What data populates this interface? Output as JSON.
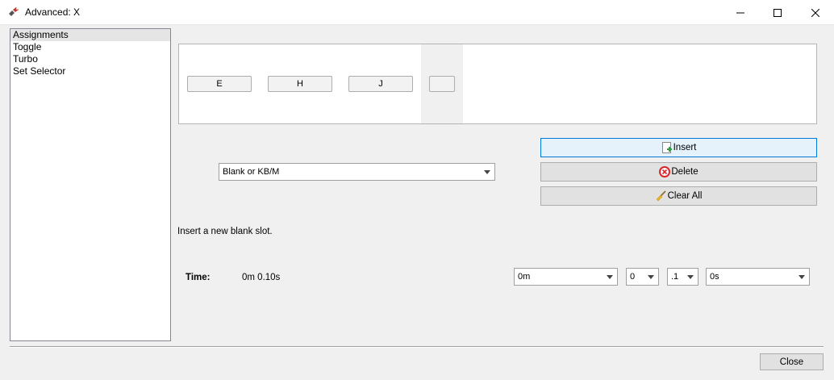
{
  "window": {
    "title": "Advanced: X",
    "icon": "gamepad-icon"
  },
  "sidebar": {
    "items": [
      {
        "label": "Assignments",
        "selected": true
      },
      {
        "label": "Toggle",
        "selected": false
      },
      {
        "label": "Turbo",
        "selected": false
      },
      {
        "label": "Set Selector",
        "selected": false
      }
    ]
  },
  "slots": {
    "buttons": [
      "E",
      "H",
      "J",
      ""
    ]
  },
  "assignment_type": {
    "selected": "Blank or KB/M"
  },
  "actions": {
    "insert_label": "Insert",
    "delete_label": "Delete",
    "clear_all_label": "Clear All"
  },
  "hint_text": "Insert a new blank slot.",
  "time": {
    "label": "Time:",
    "value": "0m 0.10s",
    "minutes": "0m",
    "seconds": "0",
    "fraction": ".1",
    "unit": "0s"
  },
  "footer": {
    "close_label": "Close"
  },
  "colors": {
    "accent": "#0078d7",
    "delete_icon": "#d9252a"
  }
}
